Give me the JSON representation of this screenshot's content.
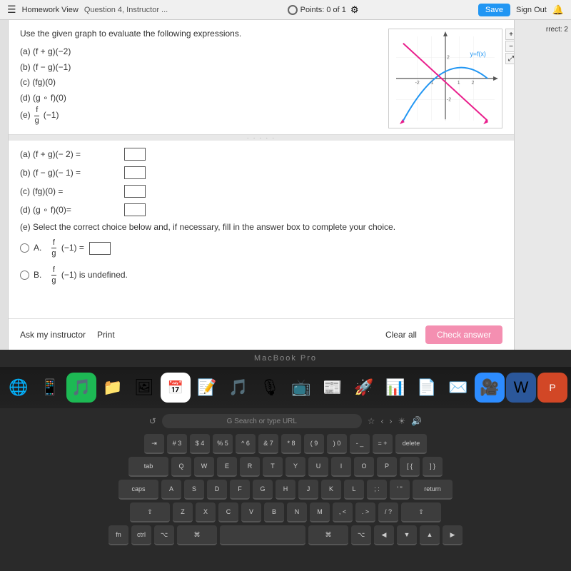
{
  "topbar": {
    "left_label": "Homework View",
    "mid_label": "Question 4, Instructor ...",
    "points_label": "Points: 0 of 1",
    "save_label": "Save",
    "signout_label": "Sign Out"
  },
  "question": {
    "instruction": "Use the given graph to evaluate the following expressions.",
    "parts": [
      "(a) (f + g)(−2)",
      "(b) (f − g)(−1)",
      "(c) (fg)(0)",
      "(d) (g ∘ f)(0)",
      "(e) (f/g)(−1)"
    ]
  },
  "answers": {
    "a_label": "(a) (f + g)(− 2) =",
    "b_label": "(b) (f − g)(− 1) =",
    "c_label": "(c) (fg)(0) =",
    "d_label": "(d) (g ∘ f)(0)=",
    "select_prompt": "(e) Select the correct choice below and, if necessary, fill in the answer box to complete your choice.",
    "option_a_label": "A.",
    "option_a_eq": "(f/g)(−1) =",
    "option_b_label": "B.",
    "option_b_text": "(f/g)(−1) is undefined."
  },
  "action_bar": {
    "ask_instructor": "Ask my instructor",
    "print": "Print",
    "clear_all": "Clear all",
    "check_answer": "Check answer"
  },
  "right_panel": {
    "correct_label": "rrect: 2"
  },
  "macbook": {
    "label": "MacBook Pro"
  },
  "url_bar": {
    "placeholder": "G Search or type URL"
  },
  "keyboard_rows": [
    [
      "⇥",
      "#",
      "$",
      "%",
      "^",
      "&",
      "*",
      "(",
      ")",
      "-",
      "+",
      "delete"
    ],
    [
      "W",
      "E",
      "R",
      "T",
      "Y",
      "U",
      "I",
      "O",
      "P",
      "{",
      "}"
    ],
    [
      "caps",
      "A",
      "S",
      "D",
      "F",
      "G",
      "H",
      "J",
      "K",
      "L",
      ":",
      "\"",
      "return"
    ],
    [
      "⇧",
      "Z",
      "X",
      "C",
      "V",
      "B",
      "N",
      "M",
      "<",
      ">",
      "?",
      "⇧"
    ],
    [
      "fn",
      "ctrl",
      "⌥",
      "⌘",
      "",
      "⌘",
      "⌥",
      "◀",
      "▼",
      "▲",
      "▶"
    ]
  ],
  "dock_icons": [
    "🌐",
    "🔍",
    "🎵",
    "📁",
    "🖼",
    "📅",
    "📝",
    "🎞",
    "📻",
    "📺",
    "⚙",
    "🗂",
    "📊",
    "📋",
    "📧",
    "💬",
    "📞",
    "🔒",
    "🔔"
  ]
}
